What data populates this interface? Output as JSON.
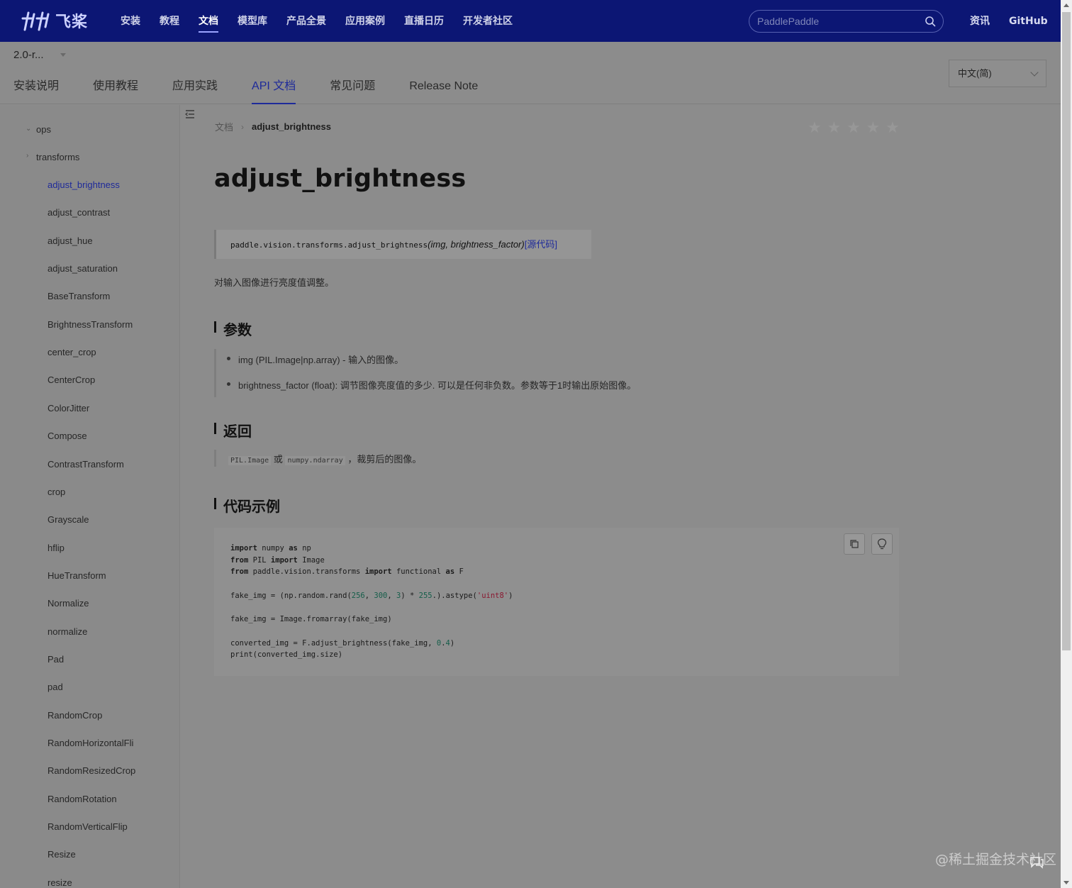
{
  "topnav": {
    "logo_text": "飞桨",
    "links": [
      "安装",
      "教程",
      "文档",
      "模型库",
      "产品全景",
      "应用案例",
      "直播日历",
      "开发者社区"
    ],
    "active_link": "文档",
    "search_placeholder": "PaddlePaddle",
    "right_links": [
      "资讯",
      "GitHub"
    ]
  },
  "subheader": {
    "version": "2.0-r...",
    "tabs": [
      "安装说明",
      "使用教程",
      "应用实践",
      "API 文档",
      "常见问题",
      "Release Note"
    ],
    "active_tab": "API 文档",
    "language": "中文(简)"
  },
  "sidebar": {
    "groups": [
      {
        "label": "ops",
        "expanded": true
      },
      {
        "label": "transforms",
        "expanded": false
      }
    ],
    "items": [
      "adjust_brightness",
      "adjust_contrast",
      "adjust_hue",
      "adjust_saturation",
      "BaseTransform",
      "BrightnessTransform",
      "center_crop",
      "CenterCrop",
      "ColorJitter",
      "Compose",
      "ContrastTransform",
      "crop",
      "Grayscale",
      "hflip",
      "HueTransform",
      "Normalize",
      "normalize",
      "Pad",
      "pad",
      "RandomCrop",
      "RandomHorizontalFli",
      "RandomResizedCrop",
      "RandomRotation",
      "RandomVerticalFlip",
      "Resize",
      "resize"
    ],
    "active_item": "adjust_brightness"
  },
  "breadcrumb": {
    "home": "文档",
    "current": "adjust_brightness"
  },
  "rating": {
    "stars_total": 5,
    "stars_filled": 0
  },
  "doc": {
    "title": "adjust_brightness",
    "signature": {
      "name": "paddle.vision.transforms.adjust_brightness",
      "params": "(img, brightness_factor)",
      "source_link": "[源代码]"
    },
    "description": "对输入图像进行亮度值调整。",
    "sections": {
      "params": "参数",
      "returns": "返回",
      "example": "代码示例"
    },
    "params": [
      "img (PIL.Image|np.array) - 输入的图像。",
      "brightness_factor (float): 调节图像亮度值的多少. 可以是任何非负数。参数等于1时输出原始图像。"
    ],
    "returns": {
      "type1": "PIL.Image",
      "or": "或",
      "type2": "numpy.ndarray",
      "text": "，裁剪后的图像。"
    },
    "code": {
      "lines": [
        "import numpy as np",
        "from PIL import Image",
        "from paddle.vision.transforms import functional as F",
        "",
        "fake_img = (np.random.rand(256, 300, 3) * 255.).astype('uint8')",
        "",
        "fake_img = Image.fromarray(fake_img)",
        "",
        "converted_img = F.adjust_brightness(fake_img, 0.4)",
        "print(converted_img.size)"
      ]
    }
  },
  "watermark": "@稀土掘金技术社区"
}
